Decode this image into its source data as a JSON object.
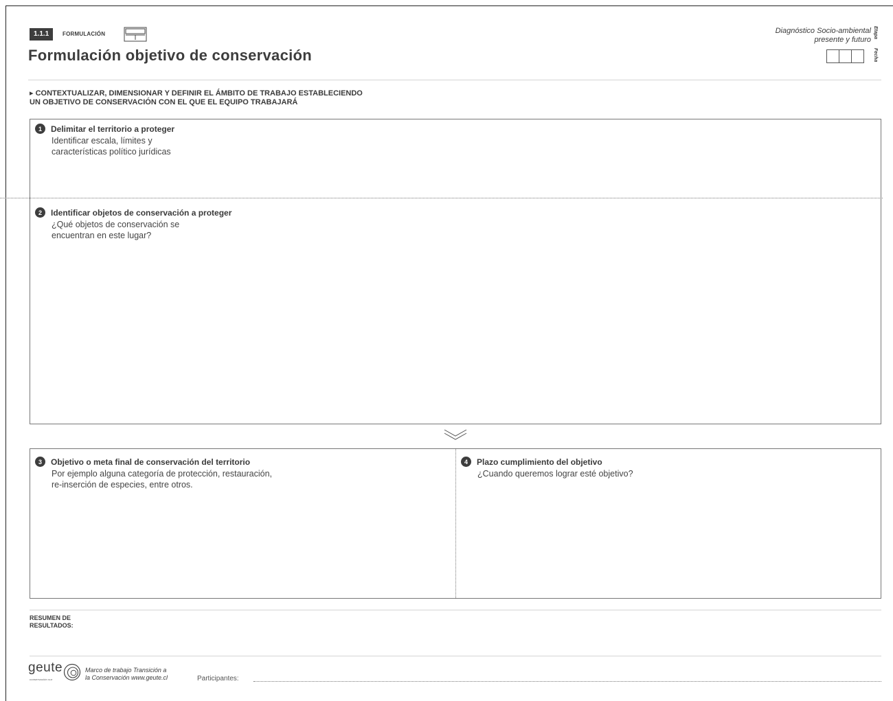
{
  "header": {
    "section_number": "1.1.1",
    "section_label": "FORMULACIÓN",
    "title": "Formulación objetivo de conservación",
    "stage_line1": "Diagnóstico Socio-ambiental",
    "stage_line2": "presente y futuro",
    "etapa_label": "Etapa",
    "fecha_label": "Fecha"
  },
  "intro": {
    "line1": "▸ CONTEXTUALIZAR, DIMENSIONAR Y DEFINIR EL ÁMBITO DE TRABAJO ESTABLECIENDO",
    "line2": "UN OBJETIVO DE CONSERVACIÓN CON EL QUE EL EQUIPO TRABAJARÁ"
  },
  "steps": [
    {
      "number": "1",
      "title": "Delimitar el territorio a proteger",
      "desc_line1": "Identificar escala, límites y",
      "desc_line2": "características político jurídicas"
    },
    {
      "number": "2",
      "title": "Identificar objetos de conservación a proteger",
      "desc_line1": "¿Qué objetos de conservación se",
      "desc_line2": "encuentran en este lugar?"
    },
    {
      "number": "3",
      "title": "Objetivo o meta final de conservación del territorio",
      "desc_line1": "Por ejemplo alguna categoría de protección, restauración,",
      "desc_line2": "re-inserción de especies, entre otros."
    },
    {
      "number": "4",
      "title": "Plazo cumplimiento del objetivo",
      "desc_line1": "¿Cuando queremos lograr esté objetivo?",
      "desc_line2": ""
    }
  ],
  "summary": {
    "line1": "RESUMEN DE",
    "line2": "RESULTADOS:"
  },
  "footer": {
    "logo_word": "geute",
    "logo_sub": "conservación sur",
    "credit_line1": "Marco de trabajo Transición a",
    "credit_line2": "la Conservación www.geute.cl",
    "participants_label": "Participantes:"
  }
}
